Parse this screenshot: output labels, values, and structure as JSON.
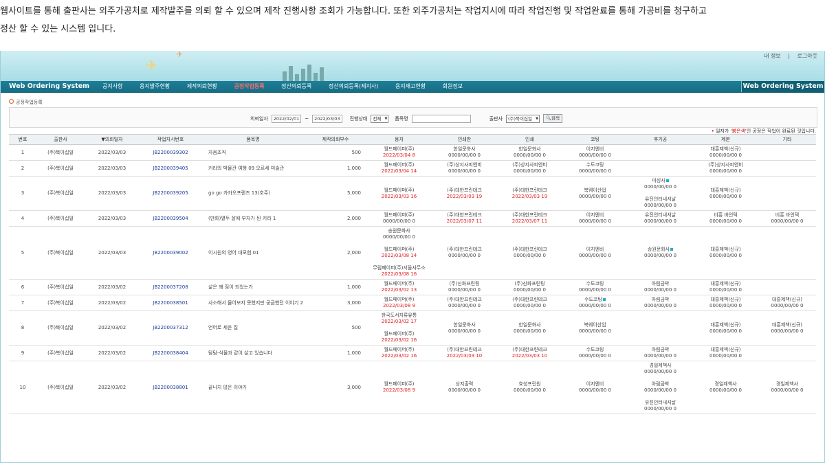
{
  "intro": {
    "line1": "웹사이트를 통해 출판사는 외주가공처로 제작발주를 의뢰 할 수 있으며 제작 진행사항 조회가 가능합니다. 또한 외주가공처는 작업지시에 따라 작업진행 및 작업완료를 통해 가공비를 청구하고",
    "line2": "정산 할 수 있는 시스템 입니다."
  },
  "header": {
    "util_links": [
      "내 정보",
      "|",
      "로그아웃"
    ],
    "brand_left": "Web Ordering System",
    "brand_right": "Web Ordering System",
    "menu": [
      "공지사항",
      "용지발주현황",
      "제작의뢰현황",
      "공정작업등록",
      "정산의뢰등록",
      "정산의뢰등록(제지사)",
      "용지재고현황",
      "회원정보"
    ],
    "active_menu": 3
  },
  "section_title": "공정작업등록",
  "search": {
    "date_label": "의뢰일자",
    "date_from": "2022/02/01",
    "tilde": "~",
    "date_to": "2022/03/03",
    "status_label": "진행상태",
    "status_value": "전체",
    "item_label": "품목명",
    "item_value": "",
    "publisher_label": "출판사",
    "publisher_value": "(주)북이십일",
    "search_button": "검색"
  },
  "note": {
    "bullet": "•",
    "prefix": "일자가 '",
    "highlight": "붉은색",
    "suffix": "'인 공정은 작업이 완료된 것입니다."
  },
  "colors": {
    "nav": "#1a7890",
    "active_menu": "#ff6b6b",
    "done_date": "#e02020",
    "code": "#1a3a9a"
  },
  "table": {
    "headers": [
      "번호",
      "출판사",
      "▼의뢰일자",
      "작업지시번호",
      "품목명",
      "제작의뢰부수",
      "용지",
      "인쇄판",
      "인쇄",
      "코팅",
      "후가공",
      "제본",
      "기타"
    ],
    "rows": [
      {
        "no": "1",
        "publisher": "(주)북이십일",
        "date": "2022/03/03",
        "code": "JB2200039302",
        "item": "자음조직",
        "qty": "500",
        "paper": [
          {
            "name": "월드페이퍼(주)",
            "date": "2022/03/04",
            "n": "8",
            "done": true
          }
        ],
        "plate": [
          {
            "name": "한일문화사",
            "date": "0000/00/00",
            "n": "0",
            "done": false
          }
        ],
        "print": [
          {
            "name": "한일문화사",
            "date": "0000/00/00",
            "n": "0",
            "done": false
          }
        ],
        "coat": [
          {
            "name": "이지엔비",
            "date": "0000/00/00",
            "n": "0",
            "done": false
          }
        ],
        "post": [],
        "bind": [
          {
            "name": "대흥제책(신규)",
            "date": "0000/00/00",
            "n": "0",
            "done": false
          }
        ],
        "etc": []
      },
      {
        "no": "2",
        "publisher": "(주)북이십일",
        "date": "2022/03/03",
        "code": "JB2200039405",
        "item": "커라의 박물관 여행 09 오르세 미술관",
        "qty": "1,000",
        "paper": [
          {
            "name": "월드페이퍼(주)",
            "date": "2022/03/04",
            "n": "14",
            "done": true
          }
        ],
        "plate": [
          {
            "name": "(주)상지사피엔비",
            "date": "0000/00/00",
            "n": "0",
            "done": false
          }
        ],
        "print": [
          {
            "name": "(주)상지사피엔비",
            "date": "0000/00/00",
            "n": "0",
            "done": false
          }
        ],
        "coat": [
          {
            "name": "수도코팅",
            "date": "0000/00/00",
            "n": "0",
            "done": false
          }
        ],
        "post": [],
        "bind": [
          {
            "name": "(주)상지사피엔비",
            "date": "0000/00/00",
            "n": "0",
            "done": false
          }
        ],
        "etc": []
      },
      {
        "no": "3",
        "publisher": "(주)북이십일",
        "date": "2022/03/03",
        "code": "JB2200039205",
        "item": "go go 카카오프렌즈 13(호주)",
        "qty": "5,000",
        "paper": [
          {
            "name": "월드페이퍼(주)",
            "date": "2022/03/03",
            "n": "16",
            "done": true
          }
        ],
        "plate": [
          {
            "name": "(주)대한프린테크",
            "date": "2022/03/03",
            "n": "19",
            "done": true
          }
        ],
        "print": [
          {
            "name": "(주)대한프린테크",
            "date": "2022/03/03",
            "n": "19",
            "done": true
          }
        ],
        "coat": [
          {
            "name": "북웨이산업",
            "date": "0000/00/00",
            "n": "0",
            "done": false
          }
        ],
        "post": [
          {
            "name": "미성사",
            "date": "0000/00/00",
            "n": "0",
            "done": false,
            "marker": true
          },
          {
            "name": "유진인터내셔날",
            "date": "0000/00/00",
            "n": "0",
            "done": false
          }
        ],
        "bind": [
          {
            "name": "대흥제책(신규)",
            "date": "0000/00/00",
            "n": "0",
            "done": false
          }
        ],
        "etc": []
      },
      {
        "no": "4",
        "publisher": "(주)북이십일",
        "date": "2022/03/03",
        "code": "JB2200039504",
        "item": "(만화)열두 살에 부자가 된 키라 1",
        "qty": "2,000",
        "paper": [
          {
            "name": "월드페이퍼(주)",
            "date": "0000/00/00",
            "n": "0",
            "done": false
          }
        ],
        "plate": [
          {
            "name": "(주)대한프린테크",
            "date": "2022/03/07",
            "n": "11",
            "done": true
          }
        ],
        "print": [
          {
            "name": "(주)대한프린테크",
            "date": "2022/03/07",
            "n": "11",
            "done": true
          }
        ],
        "coat": [
          {
            "name": "이지엔비",
            "date": "0000/00/00",
            "n": "0",
            "done": false
          }
        ],
        "post": [
          {
            "name": "유진인터내셔날",
            "date": "0000/00/00",
            "n": "0",
            "done": false
          }
        ],
        "bind": [
          {
            "name": "비흥 바인텍",
            "date": "0000/00/00",
            "n": "0",
            "done": false
          }
        ],
        "etc": [
          {
            "name": "비흥 바인텍",
            "date": "0000/00/00",
            "n": "0",
            "done": false
          }
        ]
      },
      {
        "no": "5",
        "publisher": "(주)북이십일",
        "date": "2022/03/03",
        "code": "JB2200039002",
        "item": "이시원의 영어 대모험 01",
        "qty": "2,000",
        "paper": [
          {
            "name": "송원문화사",
            "date": "0000/00/00",
            "n": "0",
            "done": false
          },
          {
            "name": "월드페이퍼(주)",
            "date": "2022/03/08",
            "n": "14",
            "done": true
          },
          {
            "name": "무림페이퍼(주)서울사무소",
            "date": "2022/03/08",
            "n": "16",
            "done": true
          }
        ],
        "plate": [
          {
            "name": "(주)대한프린테크",
            "date": "0000/00/00",
            "n": "0",
            "done": false
          }
        ],
        "print": [
          {
            "name": "(주)대한프린테크",
            "date": "0000/00/00",
            "n": "0",
            "done": false
          }
        ],
        "coat": [
          {
            "name": "이지엔비",
            "date": "0000/00/00",
            "n": "0",
            "done": false
          }
        ],
        "post": [
          {
            "name": "송원문화사",
            "date": "0000/00/00",
            "n": "0",
            "done": false,
            "marker": true
          }
        ],
        "bind": [
          {
            "name": "대흥제책(신규)",
            "date": "0000/00/00",
            "n": "0",
            "done": false
          }
        ],
        "etc": []
      },
      {
        "no": "6",
        "publisher": "(주)북이십일",
        "date": "2022/03/02",
        "code": "JB2200037208",
        "item": "삶은 왜 짐이 되었는가",
        "qty": "1,000",
        "paper": [
          {
            "name": "월드페이퍼(주)",
            "date": "2022/03/02",
            "n": "13",
            "done": true
          }
        ],
        "plate": [
          {
            "name": "(주)신화프린팅",
            "date": "0000/00/00",
            "n": "0",
            "done": false
          }
        ],
        "print": [
          {
            "name": "(주)신화프린팅",
            "date": "0000/00/00",
            "n": "0",
            "done": false
          }
        ],
        "coat": [
          {
            "name": "수도코팅",
            "date": "0000/00/00",
            "n": "0",
            "done": false
          }
        ],
        "post": [
          {
            "name": "아림금박",
            "date": "0000/00/00",
            "n": "0",
            "done": false
          }
        ],
        "bind": [
          {
            "name": "대흥제책(신규)",
            "date": "0000/00/00",
            "n": "0",
            "done": false
          }
        ],
        "etc": []
      },
      {
        "no": "7",
        "publisher": "(주)북이십일",
        "date": "2022/03/02",
        "code": "JB2200038501",
        "item": "사소해서 물어보지 못했지만 궁금했던 이야기 2",
        "qty": "3,000",
        "paper": [
          {
            "name": "월드페이퍼(주)",
            "date": "2022/03/08",
            "n": "9",
            "done": true
          }
        ],
        "plate": [
          {
            "name": "(주)대한프린테크",
            "date": "0000/00/00",
            "n": "0",
            "done": false
          }
        ],
        "print": [
          {
            "name": "(주)대한프린테크",
            "date": "0000/00/00",
            "n": "0",
            "done": false
          }
        ],
        "coat": [
          {
            "name": "수도코팅",
            "date": "0000/00/00",
            "n": "0",
            "done": false,
            "marker": true
          }
        ],
        "post": [
          {
            "name": "아림금박",
            "date": "0000/00/00",
            "n": "0",
            "done": false
          }
        ],
        "bind": [
          {
            "name": "대흥제책(신규)",
            "date": "0000/00/00",
            "n": "0",
            "done": false
          }
        ],
        "etc": [
          {
            "name": "대흥제책(신규)",
            "date": "0000/00/00",
            "n": "0",
            "done": false
          }
        ]
      },
      {
        "no": "8",
        "publisher": "(주)북이십일",
        "date": "2022/03/02",
        "code": "JB2200037312",
        "item": "언어로 세운 집",
        "qty": "500",
        "paper": [
          {
            "name": "한국도서지류유통",
            "date": "2022/03/02",
            "n": "17",
            "done": true
          },
          {
            "name": "월드페이퍼(주)",
            "date": "2022/03/02",
            "n": "16",
            "done": true
          }
        ],
        "plate": [
          {
            "name": "한일문화사",
            "date": "0000/00/00",
            "n": "0",
            "done": false
          }
        ],
        "print": [
          {
            "name": "한일문화사",
            "date": "0000/00/00",
            "n": "0",
            "done": false
          }
        ],
        "coat": [
          {
            "name": "북웨이산업",
            "date": "0000/00/00",
            "n": "0",
            "done": false
          }
        ],
        "post": [],
        "bind": [
          {
            "name": "대흥제책(신규)",
            "date": "0000/00/00",
            "n": "0",
            "done": false
          }
        ],
        "etc": [
          {
            "name": "대흥제책(신규)",
            "date": "0000/00/00",
            "n": "0",
            "done": false
          }
        ]
      },
      {
        "no": "9",
        "publisher": "(주)북이십일",
        "date": "2022/03/02",
        "code": "JB2200038404",
        "item": "탐탐-식물과 같이 살고 있습니다",
        "qty": "1,000",
        "paper": [
          {
            "name": "월드페이퍼(주)",
            "date": "2022/03/02",
            "n": "16",
            "done": true
          }
        ],
        "plate": [
          {
            "name": "(주)대한프린테크",
            "date": "2022/03/03",
            "n": "10",
            "done": true
          }
        ],
        "print": [
          {
            "name": "(주)대한프린테크",
            "date": "2022/03/03",
            "n": "10",
            "done": true
          }
        ],
        "coat": [
          {
            "name": "수도코팅",
            "date": "0000/00/00",
            "n": "0",
            "done": false
          }
        ],
        "post": [
          {
            "name": "아림금박",
            "date": "0000/00/00",
            "n": "0",
            "done": false
          }
        ],
        "bind": [
          {
            "name": "대흥제책(신규)",
            "date": "0000/00/00",
            "n": "0",
            "done": false
          }
        ],
        "etc": []
      },
      {
        "no": "10",
        "publisher": "(주)북이십일",
        "date": "2022/03/02",
        "code": "JB2200038801",
        "item": "끝나지 않은 이야기",
        "qty": "3,000",
        "paper": [
          {
            "name": "월드페이퍼(주)",
            "date": "2022/03/08",
            "n": "9",
            "done": true
          }
        ],
        "plate": [
          {
            "name": "상지출력",
            "date": "0000/00/00",
            "n": "0",
            "done": false
          }
        ],
        "print": [
          {
            "name": "효성프린원",
            "date": "0000/00/00",
            "n": "0",
            "done": false
          }
        ],
        "coat": [
          {
            "name": "이지엔비",
            "date": "0000/00/00",
            "n": "0",
            "done": false
          }
        ],
        "post": [
          {
            "name": "경일제책사",
            "date": "0000/00/00",
            "n": "0",
            "done": false
          },
          {
            "name": "아림금박",
            "date": "0000/00/00",
            "n": "0",
            "done": false
          },
          {
            "name": "유진인터내셔날",
            "date": "0000/00/00",
            "n": "0",
            "done": false
          }
        ],
        "bind": [
          {
            "name": "경일제책사",
            "date": "0000/00/00",
            "n": "0",
            "done": false
          }
        ],
        "etc": [
          {
            "name": "경일제책사",
            "date": "0000/00/00",
            "n": "0",
            "done": false
          }
        ]
      }
    ]
  }
}
